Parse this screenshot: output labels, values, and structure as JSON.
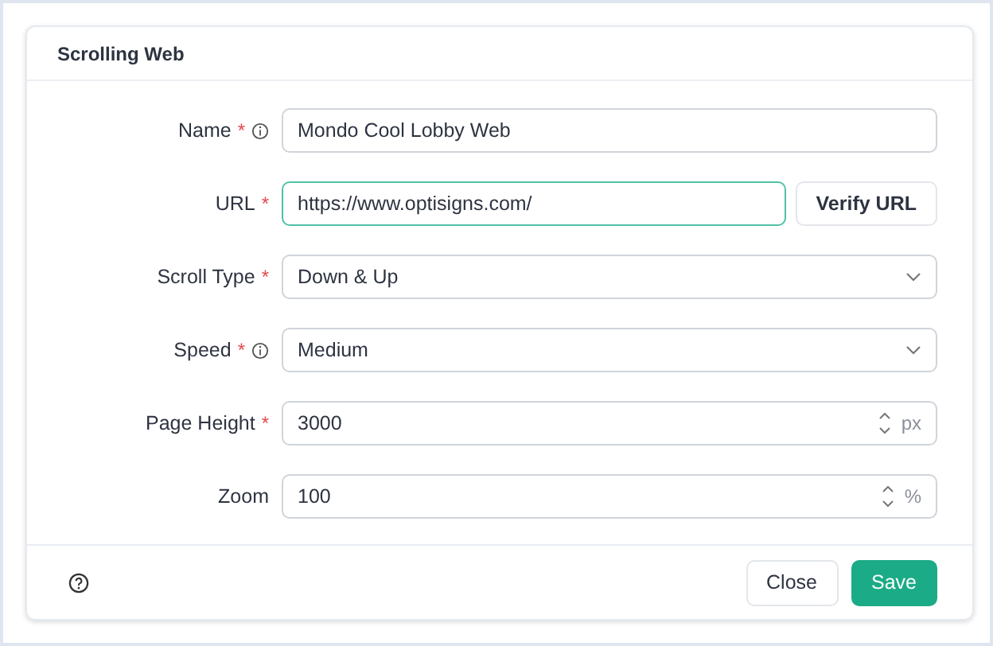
{
  "dialog": {
    "title": "Scrolling Web"
  },
  "required_mark": "*",
  "fields": [
    {
      "kind": "text",
      "label": "Name",
      "required": true,
      "info": true,
      "value": "Mondo Cool Lobby Web",
      "focused": false
    },
    {
      "kind": "text",
      "label": "URL",
      "required": true,
      "info": false,
      "value": "https://www.optisigns.com/",
      "focused": true,
      "button": "Verify URL"
    },
    {
      "kind": "select",
      "label": "Scroll Type",
      "required": true,
      "info": false,
      "value": "Down & Up",
      "focused": false
    },
    {
      "kind": "select",
      "label": "Speed",
      "required": true,
      "info": true,
      "value": "Medium",
      "focused": false
    },
    {
      "kind": "number",
      "label": "Page Height",
      "required": true,
      "info": false,
      "value": "3000",
      "unit": "px",
      "focused": false
    },
    {
      "kind": "number",
      "label": "Zoom",
      "required": false,
      "info": false,
      "value": "100",
      "unit": "%",
      "focused": false
    }
  ],
  "footer": {
    "buttons": [
      {
        "label": "Close",
        "kind": "secondary"
      },
      {
        "label": "Save",
        "kind": "primary"
      }
    ]
  }
}
